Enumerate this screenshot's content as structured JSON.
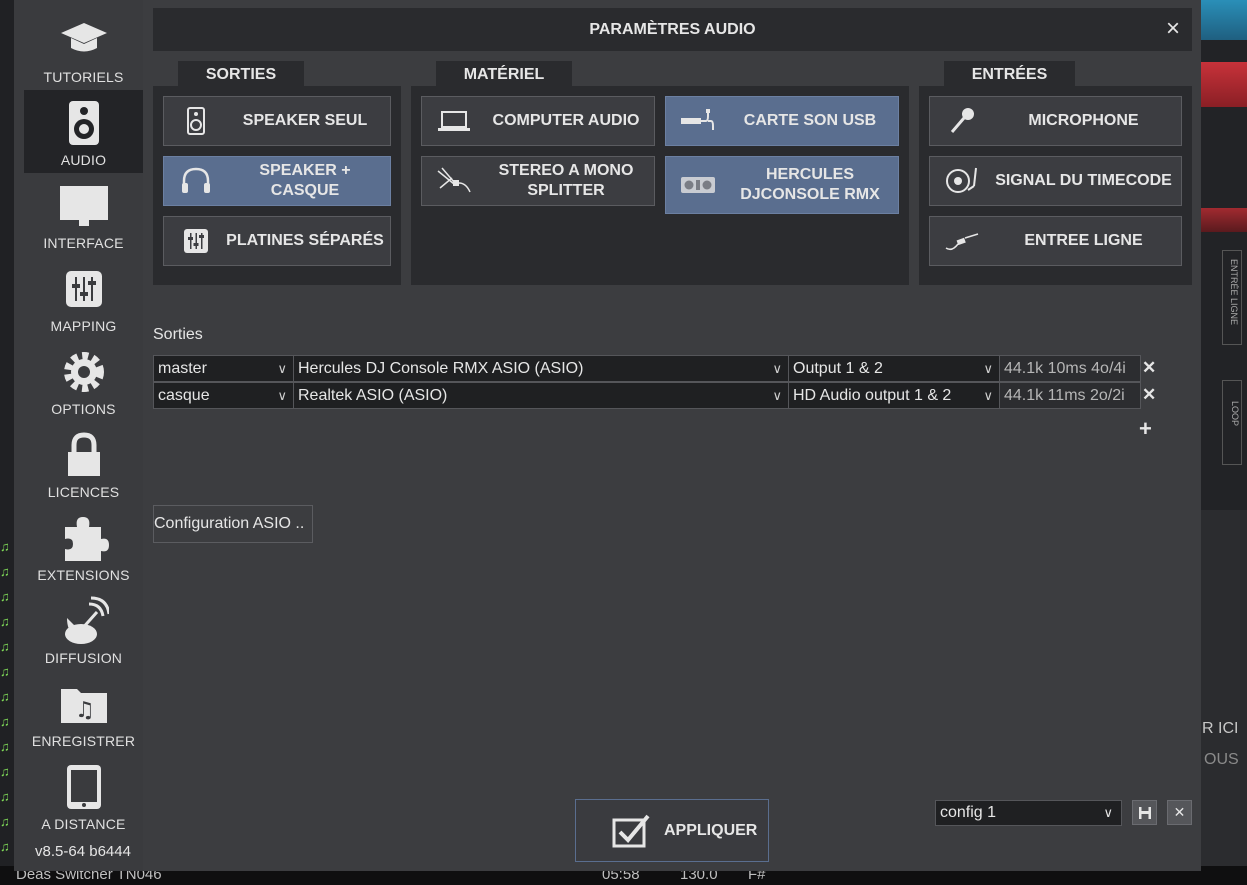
{
  "dialog": {
    "title": "PARAMÈTRES AUDIO"
  },
  "sidebar": {
    "items": [
      {
        "label": "TUTORIELS"
      },
      {
        "label": "AUDIO"
      },
      {
        "label": "INTERFACE"
      },
      {
        "label": "MAPPING"
      },
      {
        "label": "OPTIONS"
      },
      {
        "label": "LICENCES"
      },
      {
        "label": "EXTENSIONS"
      },
      {
        "label": "DIFFUSION"
      },
      {
        "label": "ENREGISTRER"
      },
      {
        "label": "A DISTANCE"
      }
    ],
    "active": "AUDIO",
    "version": "v8.5-64 b6444"
  },
  "tabs": {
    "sorties": "SORTIES",
    "materiel": "MATÉRIEL",
    "entrees": "ENTRÉES"
  },
  "presets": {
    "sorties": [
      {
        "label": "SPEAKER SEUL",
        "icon": "speaker-icon",
        "selected": false
      },
      {
        "label": "SPEAKER + CASQUE",
        "icon": "headphones-icon",
        "selected": true
      },
      {
        "label": "PLATINES SÉPARÉS",
        "icon": "mixer-icon",
        "selected": false
      }
    ],
    "materiel": [
      {
        "label": "COMPUTER AUDIO",
        "icon": "laptop-icon",
        "selected": false
      },
      {
        "label": "CARTE SON USB",
        "icon": "usb-soundcard-icon",
        "selected": true
      },
      {
        "label": "STEREO A MONO SPLITTER",
        "icon": "splitter-cable-icon",
        "selected": false
      },
      {
        "label": "HERCULES DJCONSOLE RMX",
        "icon": "dj-controller-icon",
        "selected": true
      }
    ],
    "entrees": [
      {
        "label": "MICROPHONE",
        "icon": "microphone-icon",
        "selected": false
      },
      {
        "label": "SIGNAL DU TIMECODE",
        "icon": "turntable-icon",
        "selected": false
      },
      {
        "label": "ENTREE LIGNE",
        "icon": "line-cable-icon",
        "selected": false
      }
    ]
  },
  "sorties_section": {
    "label": "Sorties",
    "rows": [
      {
        "channel": "master",
        "device": "Hercules DJ Console RMX ASIO (ASIO)",
        "output": "Output 1 & 2",
        "info": "44.1k 10ms 4o/4i"
      },
      {
        "channel": "casque",
        "device": "Realtek ASIO (ASIO)",
        "output": "HD Audio output 1 & 2",
        "info": "44.1k 11ms 2o/2i"
      }
    ],
    "remove": "✕",
    "add": "+"
  },
  "asio_button": "Configuration ASIO ..",
  "apply_button": "APPLIQUER",
  "config_select": "config 1",
  "background": {
    "footer_track": "Deas  Switcher TN046",
    "footer_time": "05:58",
    "footer_bpm": "130.0",
    "footer_key": "F#",
    "right_text1": "R ICI",
    "right_text2": "OUS",
    "vertical_label1": "ENTRÉE LIGNE",
    "vertical_label2": "LOOP"
  },
  "colors": {
    "selected": "#5a6e8f",
    "panel": "#2a2b2e",
    "dialog": "#3c3d40"
  }
}
